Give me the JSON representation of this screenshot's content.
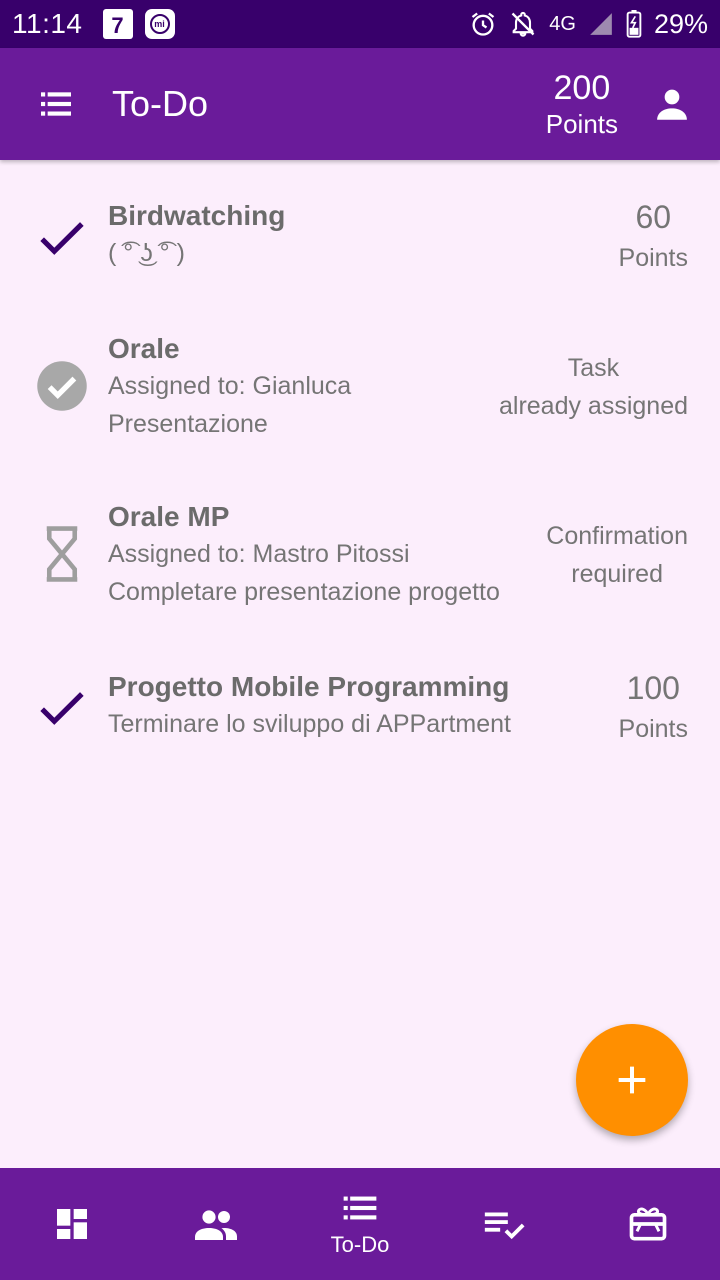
{
  "status_bar": {
    "time": "11:14",
    "calendar_day": "7",
    "network": "4G",
    "battery": "29%"
  },
  "app_bar": {
    "title": "To-Do",
    "points_value": "200",
    "points_label": "Points"
  },
  "tasks": [
    {
      "title": "Birdwatching",
      "lines": [
        "( ͡° ͜ʖ ͡° )"
      ],
      "status_icon": "check-icon",
      "right_value": "60",
      "right_label": "Points"
    },
    {
      "title": "Orale",
      "lines": [
        "Assigned to: Gianluca",
        "Presentazione"
      ],
      "status_icon": "check-circle-icon",
      "right_status_1": "Task",
      "right_status_2": "already assigned"
    },
    {
      "title": "Orale MP",
      "lines": [
        "Assigned to: Mastro Pitossi",
        "Completare presentazione progetto"
      ],
      "status_icon": "hourglass-icon",
      "right_status_1": "Confirmation",
      "right_status_2": "required"
    },
    {
      "title": "Progetto Mobile Programming",
      "lines": [
        "Terminare lo sviluppo di APPartment"
      ],
      "status_icon": "check-icon",
      "right_value": "100",
      "right_label": "Points"
    }
  ],
  "bottom_nav": {
    "items": [
      {
        "icon": "dashboard-icon",
        "label": ""
      },
      {
        "icon": "people-icon",
        "label": ""
      },
      {
        "icon": "list-icon",
        "label": "To-Do"
      },
      {
        "icon": "playlist-check-icon",
        "label": ""
      },
      {
        "icon": "gift-card-icon",
        "label": ""
      }
    ]
  },
  "colors": {
    "status_bar": "#38006B",
    "primary": "#6A1B9A",
    "background": "#FCEEFC",
    "fab": "#FF8F00",
    "check": "#38006B",
    "muted": "#757575"
  }
}
